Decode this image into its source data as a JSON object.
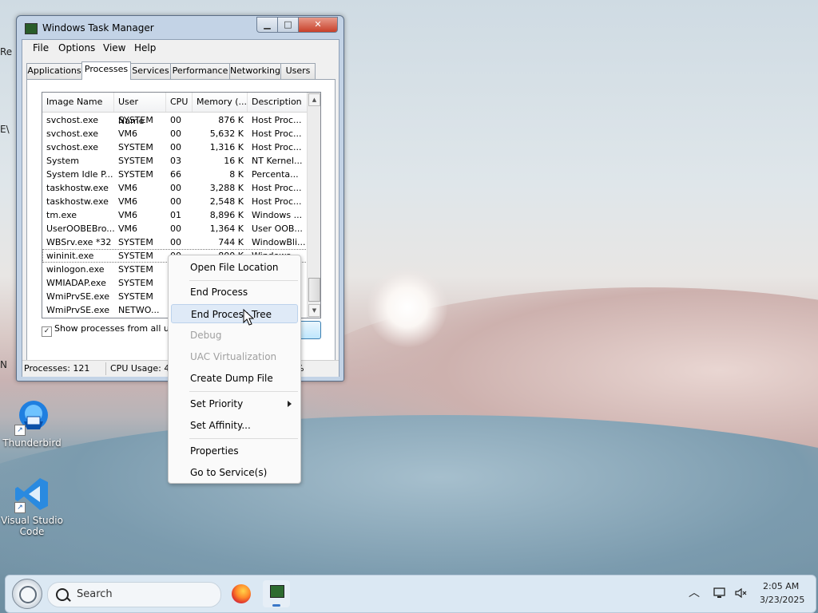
{
  "window": {
    "title": "Windows Task Manager",
    "controls": {
      "minimize": "▁",
      "maximize": "□",
      "close": "✕"
    },
    "menu": [
      "File",
      "Options",
      "View",
      "Help"
    ],
    "tabs": [
      "Applications",
      "Processes",
      "Services",
      "Performance",
      "Networking",
      "Users"
    ],
    "active_tab": "Processes"
  },
  "process_table": {
    "columns": [
      "Image Name",
      "User Name",
      "CPU",
      "Memory (...",
      "Description"
    ],
    "rows": [
      {
        "image": "svchost.exe",
        "user": "SYSTEM",
        "cpu": "00",
        "memory": "876 K",
        "desc": "Host Proc..."
      },
      {
        "image": "svchost.exe",
        "user": "VM6",
        "cpu": "00",
        "memory": "5,632 K",
        "desc": "Host Proc..."
      },
      {
        "image": "svchost.exe",
        "user": "SYSTEM",
        "cpu": "00",
        "memory": "1,316 K",
        "desc": "Host Proc..."
      },
      {
        "image": "System",
        "user": "SYSTEM",
        "cpu": "03",
        "memory": "16 K",
        "desc": "NT Kernel..."
      },
      {
        "image": "System Idle P...",
        "user": "SYSTEM",
        "cpu": "66",
        "memory": "8 K",
        "desc": "Percenta..."
      },
      {
        "image": "taskhostw.exe",
        "user": "VM6",
        "cpu": "00",
        "memory": "3,288 K",
        "desc": "Host Proc..."
      },
      {
        "image": "taskhostw.exe",
        "user": "VM6",
        "cpu": "00",
        "memory": "2,548 K",
        "desc": "Host Proc..."
      },
      {
        "image": "tm.exe",
        "user": "VM6",
        "cpu": "01",
        "memory": "8,896 K",
        "desc": "Windows ..."
      },
      {
        "image": "UserOOBEBro...",
        "user": "VM6",
        "cpu": "00",
        "memory": "1,364 K",
        "desc": "User OOB..."
      },
      {
        "image": "WBSrv.exe *32",
        "user": "SYSTEM",
        "cpu": "00",
        "memory": "744 K",
        "desc": "WindowBli..."
      },
      {
        "image": "wininit.exe",
        "user": "SYSTEM",
        "cpu": "00",
        "memory": "800 K",
        "desc": "Windows ..."
      },
      {
        "image": "winlogon.exe",
        "user": "SYSTEM",
        "cpu": "",
        "memory": "",
        "desc": ""
      },
      {
        "image": "WMIADAP.exe",
        "user": "SYSTEM",
        "cpu": "",
        "memory": "",
        "desc": ""
      },
      {
        "image": "WmiPrvSE.exe",
        "user": "SYSTEM",
        "cpu": "",
        "memory": "",
        "desc": ""
      },
      {
        "image": "WmiPrvSE.exe",
        "user": "NETWO...",
        "cpu": "",
        "memory": "",
        "desc": ""
      }
    ],
    "selected_index": 10
  },
  "show_all_label": "Show processes from all users",
  "end_process_button_label": "s",
  "status": {
    "processes": "Processes: 121",
    "cpu": "CPU Usage: 43",
    "memory_suffix": "%"
  },
  "context_menu": {
    "items": [
      {
        "label": "Open File Location",
        "disabled": false
      },
      {
        "label": "End Process",
        "disabled": false
      },
      {
        "label": "End Process Tree",
        "disabled": false,
        "highlighted": true
      },
      {
        "label": "Debug",
        "disabled": true
      },
      {
        "label": "UAC Virtualization",
        "disabled": true
      },
      {
        "label": "Create Dump File",
        "disabled": false
      },
      {
        "label": "Set Priority",
        "disabled": false,
        "submenu": true
      },
      {
        "label": "Set Affinity...",
        "disabled": false
      },
      {
        "label": "Properties",
        "disabled": false
      },
      {
        "label": "Go to Service(s)",
        "disabled": false
      }
    ]
  },
  "desktop_icons": [
    {
      "label": "Thunderbird",
      "icon": "thunderbird-icon"
    },
    {
      "label": "Visual Studio Code",
      "icon": "vscode-icon"
    }
  ],
  "edge_fragments": [
    "Re",
    "E\\",
    "N"
  ],
  "taskbar": {
    "search_placeholder": "Search",
    "apps": [
      "firefox-icon",
      "task-manager-icon"
    ],
    "tray": [
      "chevron-up-icon",
      "network-icon",
      "volume-muted-icon"
    ],
    "time": "2:05 AM",
    "date": "3/23/2025"
  },
  "colors": {
    "accent": "#3a77c8",
    "selection_highlight": "#dfeaf7",
    "disabled_text": "#a0a0a0"
  }
}
